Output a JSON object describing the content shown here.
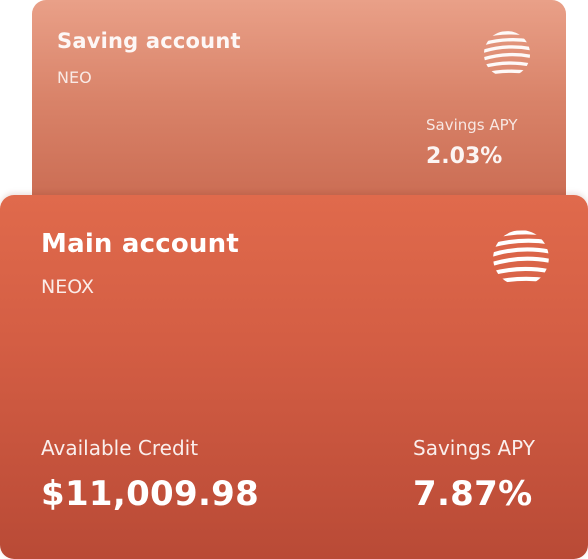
{
  "saving_card": {
    "title": "Saving account",
    "subtitle": "NEO",
    "apy_label": "Savings APY",
    "apy_value": "2.03%",
    "logo_icon": "striped-globe-logo-icon"
  },
  "main_card": {
    "title": "Main account",
    "subtitle": "NEOX",
    "credit_label": "Available Credit",
    "credit_value": "$11,009.98",
    "apy_label": "Savings APY",
    "apy_value": "7.87%",
    "logo_icon": "striped-globe-logo-icon"
  },
  "colors": {
    "back_card_top": "#e9a088",
    "back_card_bottom": "#c8684f",
    "front_card_top": "#e06a4c",
    "front_card_bottom": "#b94a36",
    "text": "#ffffff"
  }
}
